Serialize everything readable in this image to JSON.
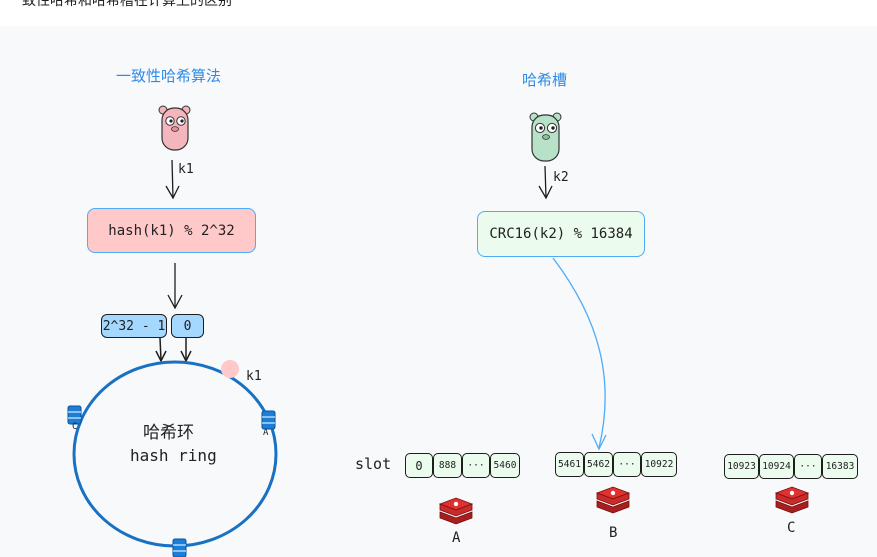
{
  "header": {
    "text": "一致性哈希和哈希槽在计算上的区别"
  },
  "left": {
    "title": "一致性哈希算法",
    "key_label": "k1",
    "hash_formula": "hash(k1) % 2^32",
    "ring_max": "2^32 - 1",
    "ring_zero": "0",
    "ring_label_cn": "哈希环",
    "ring_label_en": "hash ring",
    "point_label": "k1",
    "node_a": "A",
    "node_c": "C"
  },
  "right": {
    "title": "哈希槽",
    "key_label": "k2",
    "hash_formula": "CRC16(k2) % 16384",
    "slot_label": "slot",
    "groups": [
      {
        "name": "A",
        "slots": [
          "0",
          "888",
          "···",
          "5460"
        ]
      },
      {
        "name": "B",
        "slots": [
          "5461",
          "5462",
          "···",
          "10922"
        ]
      },
      {
        "name": "C",
        "slots": [
          "10923",
          "10924",
          "···",
          "16383"
        ]
      }
    ]
  },
  "colors": {
    "title_blue": "#2f8be5",
    "pink_box": "#ffc9c9",
    "green_box": "#ebfbee",
    "chip_blue": "#a5d8ff",
    "ring_blue": "#1971c2",
    "redis_red": "#c92a2a"
  },
  "icons": [
    "gopher-pink-icon",
    "gopher-green-icon",
    "database-icon",
    "redis-icon"
  ]
}
